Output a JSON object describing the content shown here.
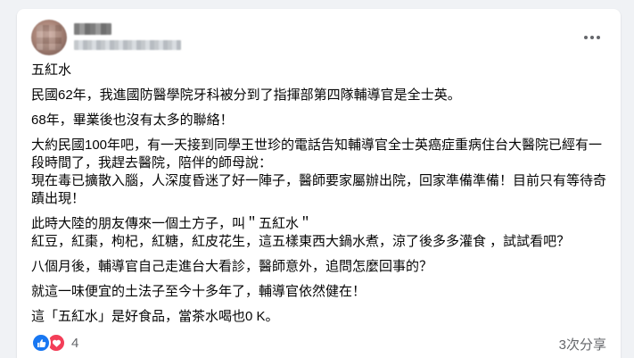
{
  "post": {
    "paragraphs": [
      "五紅水",
      "民國62年，我進國防醫學院牙科被分到了指揮部第四隊輔導官是全士英。",
      "68年，畢業後也沒有太多的聯絡！",
      "大約民國100年吧，有一天接到同學王世珍的電話告知輔導官全士英癌症重病住台大醫院已經有一\n段時間了，我趕去醫院，陪伴的師母說：\n現在毒已擴散入腦，人深度昏迷了好一陣子，醫師要家屬辦出院，回家準備準備！目前只有等待奇\n蹟出現！",
      "此時大陸的朋友傳來一個土方子，叫＂五紅水＂\n紅豆，紅棗，枸杞，紅糖，紅皮花生，這五樣東西大鍋水煮，涼了後多多灌食 ，試試看吧？",
      "八個月後，輔導官自己走進台大看診，醫師意外，追問怎麼回事的？",
      "就這一味便宜的土法子至今十多年了，輔導官依然健在！",
      "這「五紅水」是好食品，當茶水喝也0 K。"
    ]
  },
  "header": {
    "more_icon": "more-horizontal-icon"
  },
  "footer": {
    "reaction_icons": [
      "like-icon",
      "love-icon"
    ],
    "reaction_count": "4",
    "share_count": "3次分享"
  },
  "colors": {
    "like": "#1877f2",
    "love": "#f33e58",
    "secondary_text": "#65676b",
    "primary_text": "#050505",
    "background": "#f0f2f5"
  }
}
